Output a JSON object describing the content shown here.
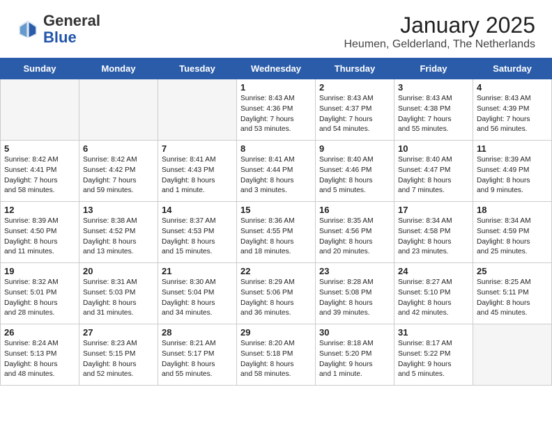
{
  "header": {
    "logo_general": "General",
    "logo_blue": "Blue",
    "month": "January 2025",
    "location": "Heumen, Gelderland, The Netherlands"
  },
  "days_of_week": [
    "Sunday",
    "Monday",
    "Tuesday",
    "Wednesday",
    "Thursday",
    "Friday",
    "Saturday"
  ],
  "weeks": [
    [
      {
        "day": "",
        "info": ""
      },
      {
        "day": "",
        "info": ""
      },
      {
        "day": "",
        "info": ""
      },
      {
        "day": "1",
        "info": "Sunrise: 8:43 AM\nSunset: 4:36 PM\nDaylight: 7 hours\nand 53 minutes."
      },
      {
        "day": "2",
        "info": "Sunrise: 8:43 AM\nSunset: 4:37 PM\nDaylight: 7 hours\nand 54 minutes."
      },
      {
        "day": "3",
        "info": "Sunrise: 8:43 AM\nSunset: 4:38 PM\nDaylight: 7 hours\nand 55 minutes."
      },
      {
        "day": "4",
        "info": "Sunrise: 8:43 AM\nSunset: 4:39 PM\nDaylight: 7 hours\nand 56 minutes."
      }
    ],
    [
      {
        "day": "5",
        "info": "Sunrise: 8:42 AM\nSunset: 4:41 PM\nDaylight: 7 hours\nand 58 minutes."
      },
      {
        "day": "6",
        "info": "Sunrise: 8:42 AM\nSunset: 4:42 PM\nDaylight: 7 hours\nand 59 minutes."
      },
      {
        "day": "7",
        "info": "Sunrise: 8:41 AM\nSunset: 4:43 PM\nDaylight: 8 hours\nand 1 minute."
      },
      {
        "day": "8",
        "info": "Sunrise: 8:41 AM\nSunset: 4:44 PM\nDaylight: 8 hours\nand 3 minutes."
      },
      {
        "day": "9",
        "info": "Sunrise: 8:40 AM\nSunset: 4:46 PM\nDaylight: 8 hours\nand 5 minutes."
      },
      {
        "day": "10",
        "info": "Sunrise: 8:40 AM\nSunset: 4:47 PM\nDaylight: 8 hours\nand 7 minutes."
      },
      {
        "day": "11",
        "info": "Sunrise: 8:39 AM\nSunset: 4:49 PM\nDaylight: 8 hours\nand 9 minutes."
      }
    ],
    [
      {
        "day": "12",
        "info": "Sunrise: 8:39 AM\nSunset: 4:50 PM\nDaylight: 8 hours\nand 11 minutes."
      },
      {
        "day": "13",
        "info": "Sunrise: 8:38 AM\nSunset: 4:52 PM\nDaylight: 8 hours\nand 13 minutes."
      },
      {
        "day": "14",
        "info": "Sunrise: 8:37 AM\nSunset: 4:53 PM\nDaylight: 8 hours\nand 15 minutes."
      },
      {
        "day": "15",
        "info": "Sunrise: 8:36 AM\nSunset: 4:55 PM\nDaylight: 8 hours\nand 18 minutes."
      },
      {
        "day": "16",
        "info": "Sunrise: 8:35 AM\nSunset: 4:56 PM\nDaylight: 8 hours\nand 20 minutes."
      },
      {
        "day": "17",
        "info": "Sunrise: 8:34 AM\nSunset: 4:58 PM\nDaylight: 8 hours\nand 23 minutes."
      },
      {
        "day": "18",
        "info": "Sunrise: 8:34 AM\nSunset: 4:59 PM\nDaylight: 8 hours\nand 25 minutes."
      }
    ],
    [
      {
        "day": "19",
        "info": "Sunrise: 8:32 AM\nSunset: 5:01 PM\nDaylight: 8 hours\nand 28 minutes."
      },
      {
        "day": "20",
        "info": "Sunrise: 8:31 AM\nSunset: 5:03 PM\nDaylight: 8 hours\nand 31 minutes."
      },
      {
        "day": "21",
        "info": "Sunrise: 8:30 AM\nSunset: 5:04 PM\nDaylight: 8 hours\nand 34 minutes."
      },
      {
        "day": "22",
        "info": "Sunrise: 8:29 AM\nSunset: 5:06 PM\nDaylight: 8 hours\nand 36 minutes."
      },
      {
        "day": "23",
        "info": "Sunrise: 8:28 AM\nSunset: 5:08 PM\nDaylight: 8 hours\nand 39 minutes."
      },
      {
        "day": "24",
        "info": "Sunrise: 8:27 AM\nSunset: 5:10 PM\nDaylight: 8 hours\nand 42 minutes."
      },
      {
        "day": "25",
        "info": "Sunrise: 8:25 AM\nSunset: 5:11 PM\nDaylight: 8 hours\nand 45 minutes."
      }
    ],
    [
      {
        "day": "26",
        "info": "Sunrise: 8:24 AM\nSunset: 5:13 PM\nDaylight: 8 hours\nand 48 minutes."
      },
      {
        "day": "27",
        "info": "Sunrise: 8:23 AM\nSunset: 5:15 PM\nDaylight: 8 hours\nand 52 minutes."
      },
      {
        "day": "28",
        "info": "Sunrise: 8:21 AM\nSunset: 5:17 PM\nDaylight: 8 hours\nand 55 minutes."
      },
      {
        "day": "29",
        "info": "Sunrise: 8:20 AM\nSunset: 5:18 PM\nDaylight: 8 hours\nand 58 minutes."
      },
      {
        "day": "30",
        "info": "Sunrise: 8:18 AM\nSunset: 5:20 PM\nDaylight: 9 hours\nand 1 minute."
      },
      {
        "day": "31",
        "info": "Sunrise: 8:17 AM\nSunset: 5:22 PM\nDaylight: 9 hours\nand 5 minutes."
      },
      {
        "day": "",
        "info": ""
      }
    ]
  ]
}
